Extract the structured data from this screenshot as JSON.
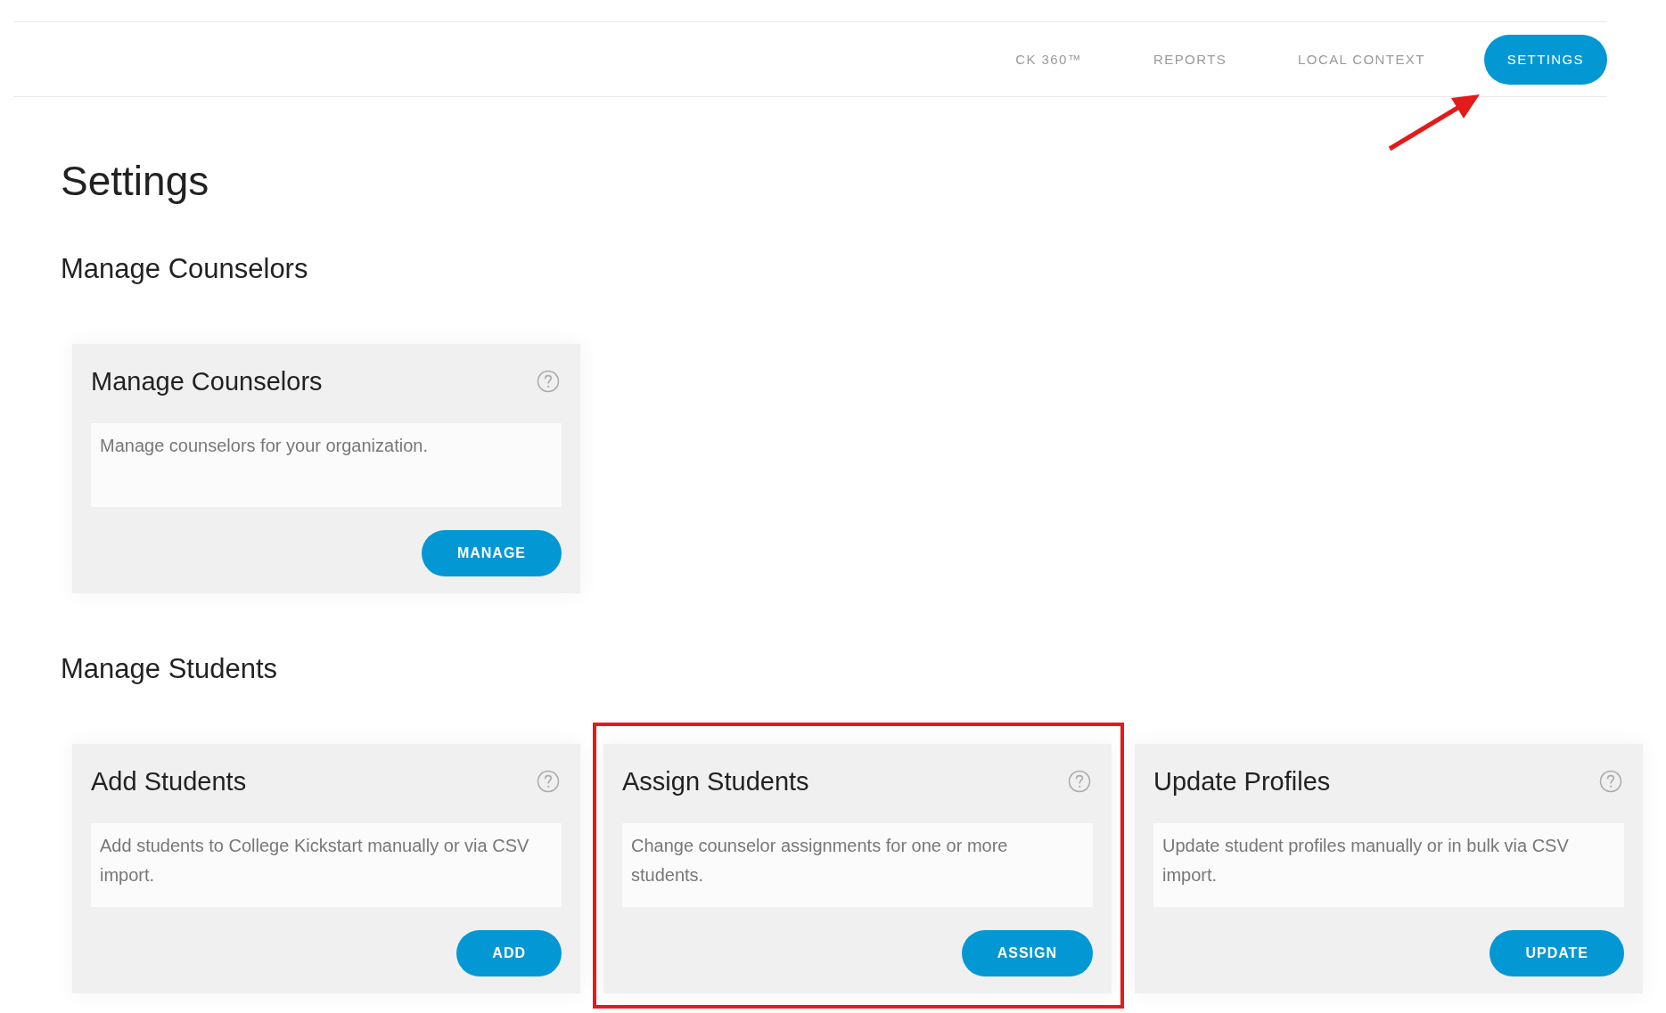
{
  "nav": [
    {
      "label": "CK 360™",
      "selected": false,
      "pointed_at": false
    },
    {
      "label": "REPORTS",
      "selected": false,
      "pointed_at": false
    },
    {
      "label": "LOCAL CONTEXT",
      "selected": false,
      "pointed_at": false
    },
    {
      "label": "SETTINGS",
      "selected": true,
      "pointed_at": true
    }
  ],
  "page_title": "Settings",
  "sections": [
    {
      "heading": "Manage Counselors",
      "cards": [
        {
          "title": "Manage Counselors",
          "description": "Manage counselors for your organization.",
          "button": "MANAGE",
          "highlighted": false
        }
      ]
    },
    {
      "heading": "Manage Students",
      "cards": [
        {
          "title": "Add Students",
          "description": "Add students to College Kickstart manually or via CSV import.",
          "button": "ADD",
          "highlighted": false
        },
        {
          "title": "Assign Students",
          "description": "Change counselor assignments for one or more students.",
          "button": "ASSIGN",
          "highlighted": true
        },
        {
          "title": "Update Profiles",
          "description": "Update student profiles manually or in bulk via CSV import.",
          "button": "UPDATE",
          "highlighted": false
        }
      ]
    }
  ]
}
